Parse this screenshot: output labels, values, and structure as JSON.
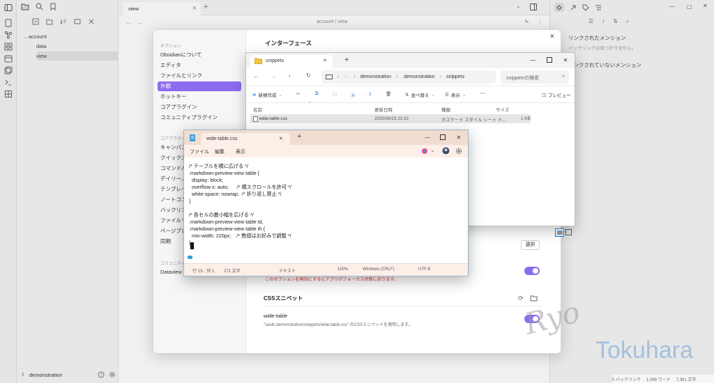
{
  "obsidian": {
    "tab_title": "view",
    "breadcrumb": {
      "part1": "account",
      "sep": "/",
      "part2": "view"
    },
    "tree": [
      {
        "label": "account"
      },
      {
        "label": "data"
      },
      {
        "label": "view"
      }
    ],
    "vault_name": "demonstration",
    "right_panel": {
      "backlinks_title": "リンクされたメンション",
      "backlinks_empty": "バックリンクは見つかりません。",
      "unlinked_title": "リンクされていないメンション"
    },
    "statusbar": {
      "backlinks": "0 バックリンク",
      "words": "1,066 ワード",
      "chars": "7,361 文字"
    }
  },
  "settings": {
    "group_options": "オプション",
    "nav_options": [
      "Obsidianについて",
      "エディタ",
      "ファイルとリンク",
      "外観",
      "ホットキー",
      "コアプラグイン",
      "コミュニティプラグイン"
    ],
    "active_index": 3,
    "group_core": "コアプラグイン",
    "nav_core": [
      "キャンバス",
      "クイックスイッチャー",
      "コマンドパレット",
      "デイリーノート",
      "テンプレート",
      "ノートコンポーザー",
      "バックリンク",
      "ファイルリカバリー",
      "ページプレビュー",
      "同期"
    ],
    "group_community": "コミュニティプラグイン",
    "nav_community": [
      "Dataview"
    ],
    "page_title": "インターフェース",
    "select_button": "選択",
    "warning_text": "このオプションを無効にするとアプリがフォーカス状態に戻ります。",
    "css_section_title": "CSSスニペット",
    "snippet_name": "wide-table",
    "snippet_desc": "\"vault/.demonstration/snippets/wide-table.css\" のCSSスニペットを適用します。"
  },
  "explorer": {
    "tab_title": "snippets",
    "path": [
      "demonstration",
      ".demonstration",
      "snippets"
    ],
    "search_placeholder": "snippetsの検索",
    "cmd": {
      "new": "新規作成",
      "sort": "並べ替え",
      "view": "表示",
      "more": "···",
      "preview": "プレビュー"
    },
    "columns": [
      "名前",
      "更新日時",
      "種類",
      "サイズ"
    ],
    "rows": [
      {
        "name": "wide-table.css",
        "modified": "2025/08/23 21:02",
        "type": "カスケード スタイル シート ド...",
        "size": "1 KB"
      }
    ]
  },
  "notepad": {
    "tab_title": "wide-table.css",
    "menu": [
      "ファイル",
      "編集",
      "表示"
    ],
    "code": [
      "/* テーブルを横に広げる */",
      ".markdown-preview-view table {",
      "  display: block;",
      "  overflow-x: auto;      /* 横スクロールを許可 */",
      "  white-space: nowrap;  /* 折り返し禁止 */",
      "}",
      "",
      "/* 各セルの最小幅を広げる */",
      ".markdown-preview-view table td,",
      ".markdown-preview-view table th {",
      "  min-width: 220px;    /* 数値はお好みで調整 */",
      "}"
    ],
    "status": {
      "position": "行 13、列 1",
      "chars": "271 文字",
      "mode": "テキスト",
      "zoom": "100%",
      "eol": "Windows (CRLF)",
      "encoding": "UTF-8"
    }
  },
  "watermark": {
    "signature": "Ryo",
    "name": "Tokuhara"
  },
  "colors": {
    "accent": "#8b6cf0",
    "notepad_title": "#f1dcd0",
    "explorer_bg": "#f3f3f3"
  }
}
